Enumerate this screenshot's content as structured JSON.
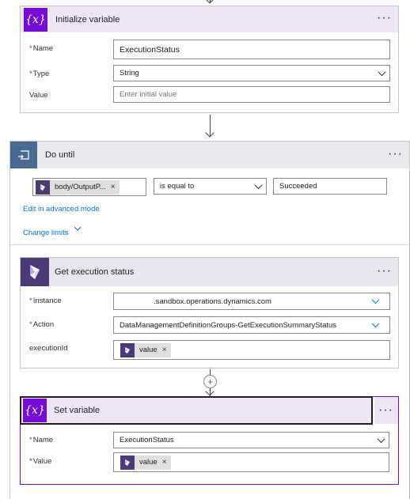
{
  "colors": {
    "variable_purple": "#770bd6",
    "variable_header_bg": "#eee5f7",
    "loop_blue": "#486991",
    "loop_header_bg": "#e8eaee",
    "d365_purple": "#4b3a76",
    "link_blue": "#0078d4",
    "required_red": "#a4262c"
  },
  "more_icon": "···",
  "initialize_variable": {
    "icon": "variable-icon",
    "icon_text": "{x}",
    "title": "Initialize variable",
    "fields": {
      "name": {
        "label": "Name",
        "value": "ExecutionStatus"
      },
      "type": {
        "label": "Type",
        "value": "String"
      },
      "value": {
        "label": "Value",
        "placeholder": "Enter initial value"
      }
    }
  },
  "do_until": {
    "icon": "loop-icon",
    "title": "Do until",
    "condition": {
      "left_token": "body/OutputP...",
      "operator": "is equal to",
      "right_value": "Succeeded"
    },
    "edit_advanced": "Edit in advanced mode",
    "change_limits": "Change limits"
  },
  "get_execution_status": {
    "icon": "dynamics-365-icon",
    "title": "Get execution status",
    "fields": {
      "instance": {
        "label": "Instance",
        "value": ".sandbox.operations.dynamics.com"
      },
      "action": {
        "label": "Action",
        "value": "DataManagementDefinitionGroups-GetExecutionSummaryStatus"
      },
      "execution_id": {
        "label": "executionId",
        "token": "value"
      }
    }
  },
  "insert_step": {
    "symbol": "+"
  },
  "set_variable": {
    "icon": "variable-icon",
    "icon_text": "{x}",
    "title": "Set variable",
    "fields": {
      "name": {
        "label": "Name",
        "value": "ExecutionStatus"
      },
      "value": {
        "label": "Value",
        "token": "value"
      }
    }
  },
  "token_remove": "×"
}
